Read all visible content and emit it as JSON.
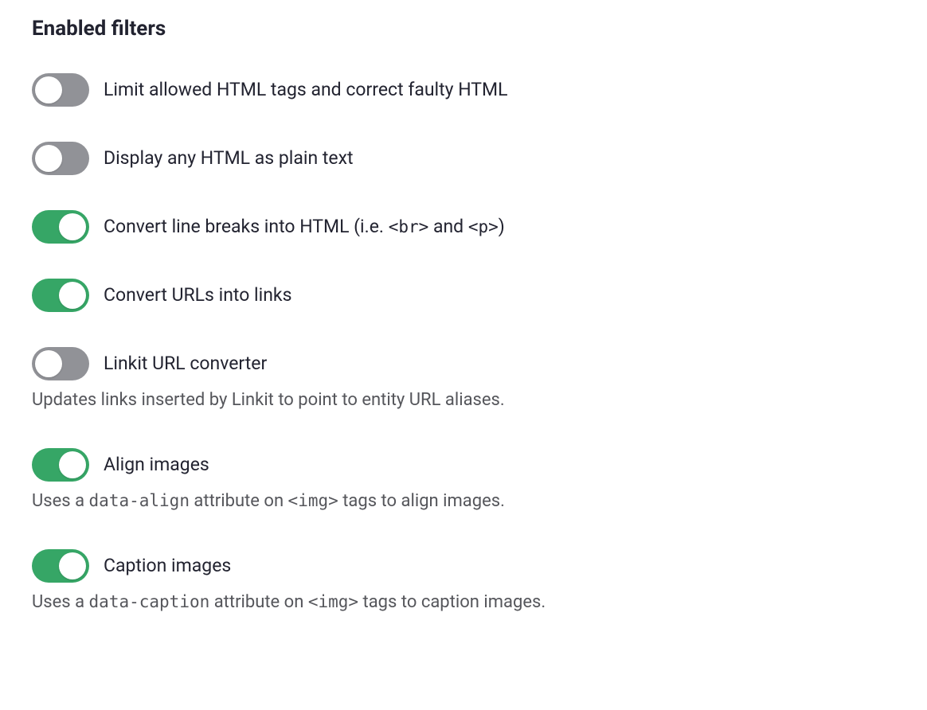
{
  "section": {
    "title": "Enabled filters"
  },
  "filters": [
    {
      "id": "limit-html",
      "label": "Limit allowed HTML tags and correct faulty HTML",
      "enabled": false,
      "description": ""
    },
    {
      "id": "display-plain",
      "label": "Display any HTML as plain text",
      "enabled": false,
      "description": ""
    },
    {
      "id": "convert-linebreaks",
      "label_parts": [
        "Convert line breaks into HTML (i.e. ",
        "<br>",
        " and ",
        "<p>",
        ")"
      ],
      "enabled": true,
      "description": ""
    },
    {
      "id": "convert-urls",
      "label": "Convert URLs into links",
      "enabled": true,
      "description": ""
    },
    {
      "id": "linkit",
      "label": "Linkit URL converter",
      "enabled": false,
      "description": "Updates links inserted by Linkit to point to entity URL aliases."
    },
    {
      "id": "align-images",
      "label": "Align images",
      "enabled": true,
      "description_parts": [
        "Uses a ",
        "data-align",
        " attribute on ",
        "<img>",
        " tags to align images."
      ]
    },
    {
      "id": "caption-images",
      "label": "Caption images",
      "enabled": true,
      "description_parts": [
        "Uses a ",
        "data-caption",
        " attribute on ",
        "<img>",
        " tags to caption images."
      ]
    }
  ]
}
